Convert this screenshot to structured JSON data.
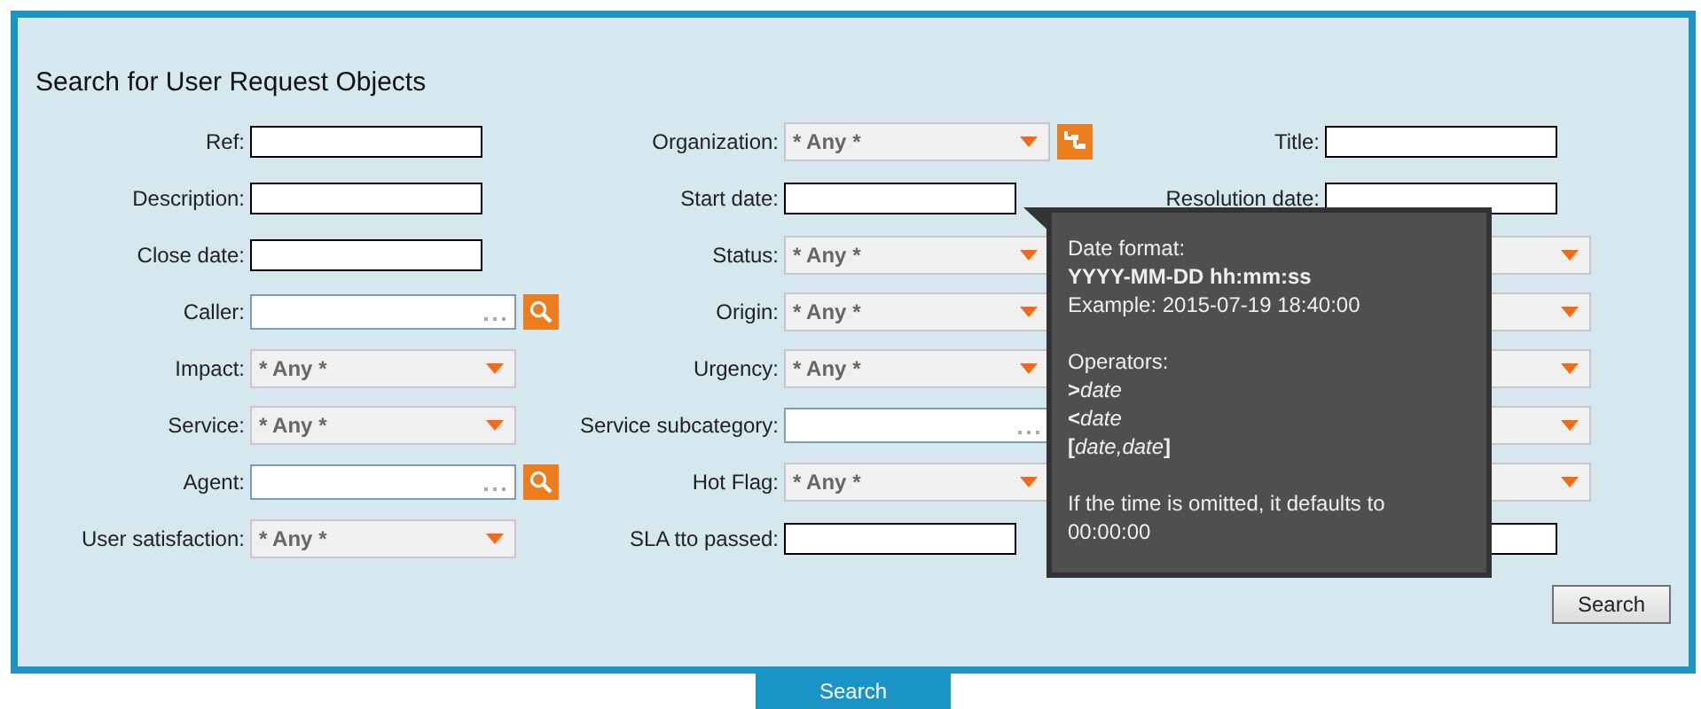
{
  "title": "Search for User Request Objects",
  "rows": [
    [
      {
        "label": "Ref:",
        "kind": "text"
      },
      {
        "label": "Organization:",
        "kind": "select",
        "value": "* Any *",
        "action": {
          "kind": "tree"
        }
      },
      {
        "label": "Title:",
        "kind": "text"
      }
    ],
    [
      {
        "label": "Description:",
        "kind": "text"
      },
      {
        "label": "Start date:",
        "kind": "text"
      },
      {
        "label": "Resolution date:",
        "kind": "text"
      }
    ],
    [
      {
        "label": "Close date:",
        "kind": "text"
      },
      {
        "label": "Status:",
        "kind": "select",
        "value": "* Any *"
      },
      {
        "kind": "select"
      }
    ],
    [
      {
        "label": "Caller:",
        "kind": "lookup",
        "action": {
          "kind": "search"
        }
      },
      {
        "label": "Origin:",
        "kind": "select",
        "value": "* Any *"
      },
      {
        "kind": "select"
      }
    ],
    [
      {
        "label": "Impact:",
        "kind": "select",
        "value": "* Any *"
      },
      {
        "label": "Urgency:",
        "kind": "select",
        "value": "* Any *"
      },
      {
        "kind": "select"
      }
    ],
    [
      {
        "label": "Service:",
        "kind": "select",
        "value": "* Any *"
      },
      {
        "label": "Service subcategory:",
        "kind": "lookup"
      },
      {
        "kind": "select"
      }
    ],
    [
      {
        "label": "Agent:",
        "kind": "lookup",
        "action": {
          "kind": "search"
        }
      },
      {
        "label": "Hot Flag:",
        "kind": "select",
        "value": "* Any *"
      },
      {
        "kind": "select"
      }
    ],
    [
      {
        "label": "User satisfaction:",
        "kind": "select",
        "value": "* Any *"
      },
      {
        "label": "SLA tto passed:",
        "kind": "text"
      },
      {
        "kind": "text"
      }
    ]
  ],
  "search_button": "Search",
  "tooltip": {
    "lines": [
      {
        "kind": "text",
        "text": "Date format:"
      },
      {
        "kind": "bold",
        "text": "YYYY-MM-DD hh:mm:ss"
      },
      {
        "kind": "text",
        "text": "Example: 2015-07-19 18:40:00"
      },
      {
        "kind": "gap"
      },
      {
        "kind": "text",
        "text": "Operators:"
      },
      {
        "kind": "operator",
        "parts": [
          {
            "kind": "symbol",
            "text": ">"
          },
          {
            "kind": "arg",
            "text": "date"
          }
        ]
      },
      {
        "kind": "operator",
        "parts": [
          {
            "kind": "symbol",
            "text": "<"
          },
          {
            "kind": "arg",
            "text": "date"
          }
        ]
      },
      {
        "kind": "operator",
        "parts": [
          {
            "kind": "symbol",
            "text": "["
          },
          {
            "kind": "arg",
            "text": "date,date"
          },
          {
            "kind": "symbol",
            "text": "]"
          }
        ]
      },
      {
        "kind": "gap"
      },
      {
        "kind": "text",
        "text": "If the time is omitted, it defaults to"
      },
      {
        "kind": "text",
        "text": "00:00:00"
      }
    ]
  },
  "bottom_tab": "Search"
}
